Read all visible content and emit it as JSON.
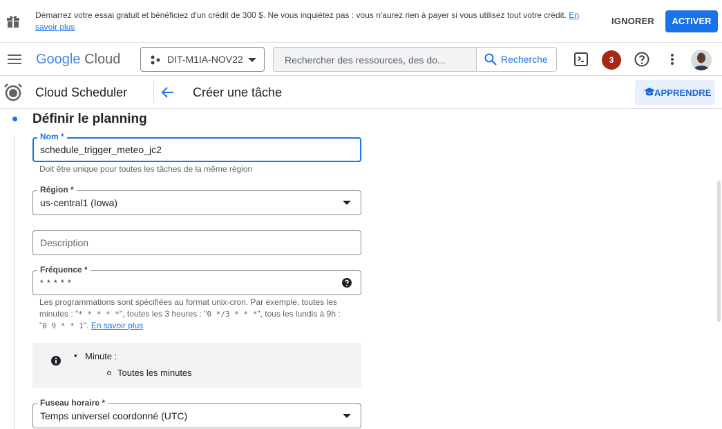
{
  "banner": {
    "message": "Démarrez votre essai gratuit et bénéficiez d'un crédit de 300 $. Ne vous inquiétez pas : vous n'aurez rien à payer si vous utilisez tout votre crédit.",
    "learn_more": "En savoir plus",
    "ignore_label": "IGNORER",
    "activate_label": "ACTIVER"
  },
  "header": {
    "logo_google": "Google",
    "logo_cloud": "Cloud",
    "project": "DIT-M1IA-NOV22",
    "search_placeholder": "Rechercher des ressources, des do...",
    "search_button": "Recherche",
    "notifications_count": "3"
  },
  "subheader": {
    "service": "Cloud Scheduler",
    "page_title": "Créer une tâche",
    "learn_button": "APPRENDRE"
  },
  "form": {
    "section_title": "Définir le planning",
    "name": {
      "label": "Nom *",
      "value": "schedule_trigger_meteo_jc2",
      "hint": "Doit être unique pour toutes les tâches de la même région"
    },
    "region": {
      "label": "Région *",
      "value": "us-central1 (Iowa)"
    },
    "description": {
      "placeholder": "Description"
    },
    "frequency": {
      "label": "Fréquence *",
      "value": "* * * * *",
      "hint_1": "Les programmations sont spécifiées au format unix-cron. Par exemple, toutes les",
      "hint_2a": "minutes : \"",
      "example_every_minute": "* * * * *",
      "hint_2b": "\", toutes les 3 heures : \"",
      "example_every_3h": "0 */3 * * *",
      "hint_2c": "\", tous les lundis à 9h :",
      "hint_3a": "\"",
      "example_monday": "0 9 * * 1",
      "hint_3b": "\". ",
      "learn_more": "En savoir plus"
    },
    "info": {
      "item": "Minute :",
      "subitem": "Toutes les minutes"
    },
    "timezone": {
      "label": "Fuseau horaire *",
      "value": "Temps universel coordonné (UTC)"
    }
  },
  "colors": {
    "primary": "#1a73e8",
    "badge": "#a52714",
    "info_bg": "#f1f3f4"
  }
}
